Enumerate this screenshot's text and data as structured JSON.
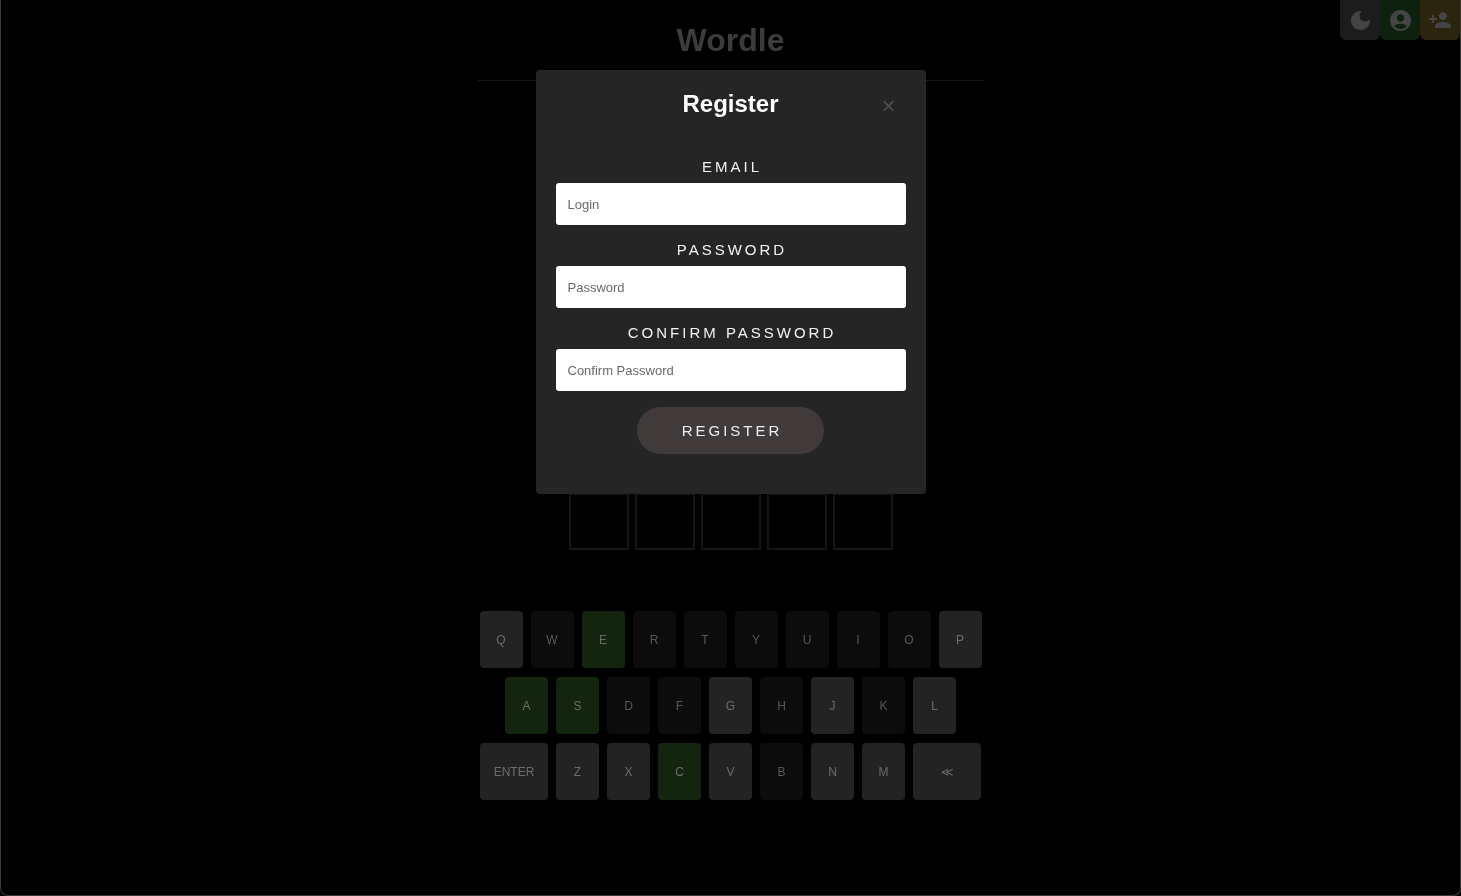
{
  "toolbar": [
    {
      "kind": "theme"
    },
    {
      "kind": "account"
    },
    {
      "kind": "add-user"
    }
  ],
  "header": {
    "title": "Wordle"
  },
  "keyboard": {
    "rows": [
      {
        "keys": [
          {
            "label": "Q",
            "kind": "letter",
            "correct": false,
            "absent": false
          },
          {
            "label": "W",
            "kind": "letter",
            "correct": false,
            "absent": true
          },
          {
            "label": "E",
            "kind": "letter",
            "correct": true,
            "absent": false
          },
          {
            "label": "R",
            "kind": "letter",
            "correct": false,
            "absent": true
          },
          {
            "label": "T",
            "kind": "letter",
            "correct": false,
            "absent": true
          },
          {
            "label": "Y",
            "kind": "letter",
            "correct": false,
            "absent": true
          },
          {
            "label": "U",
            "kind": "letter",
            "correct": false,
            "absent": true
          },
          {
            "label": "I",
            "kind": "letter",
            "correct": false,
            "absent": true
          },
          {
            "label": "O",
            "kind": "letter",
            "correct": false,
            "absent": true
          },
          {
            "label": "P",
            "kind": "letter",
            "correct": false,
            "absent": false
          }
        ]
      },
      {
        "keys": [
          {
            "label": "A",
            "kind": "letter",
            "correct": true,
            "absent": false
          },
          {
            "label": "S",
            "kind": "letter",
            "correct": true,
            "absent": false
          },
          {
            "label": "D",
            "kind": "letter",
            "correct": false,
            "absent": true
          },
          {
            "label": "F",
            "kind": "letter",
            "correct": false,
            "absent": true
          },
          {
            "label": "G",
            "kind": "letter",
            "correct": false,
            "absent": false
          },
          {
            "label": "H",
            "kind": "letter",
            "correct": false,
            "absent": true
          },
          {
            "label": "J",
            "kind": "letter",
            "correct": false,
            "absent": false
          },
          {
            "label": "K",
            "kind": "letter",
            "correct": false,
            "absent": true
          },
          {
            "label": "L",
            "kind": "letter",
            "correct": false,
            "absent": false
          }
        ]
      },
      {
        "keys": [
          {
            "label": "ENTER",
            "kind": "wide",
            "correct": false,
            "absent": false
          },
          {
            "label": "Z",
            "kind": "letter",
            "correct": false,
            "absent": false
          },
          {
            "label": "X",
            "kind": "letter",
            "correct": false,
            "absent": false
          },
          {
            "label": "C",
            "kind": "letter",
            "correct": true,
            "absent": false
          },
          {
            "label": "V",
            "kind": "letter",
            "correct": false,
            "absent": false
          },
          {
            "label": "B",
            "kind": "letter",
            "correct": false,
            "absent": true
          },
          {
            "label": "N",
            "kind": "letter",
            "correct": false,
            "absent": false
          },
          {
            "label": "M",
            "kind": "letter",
            "correct": false,
            "absent": false
          },
          {
            "label": "≪",
            "kind": "wide",
            "correct": false,
            "absent": false
          }
        ]
      }
    ]
  },
  "dialog": {
    "title": "Register",
    "close": "×",
    "fields": [
      {
        "label": "EMAIL",
        "placeholder": "Login"
      },
      {
        "label": "PASSWORD",
        "placeholder": "Password"
      },
      {
        "label": "CONFIRM PASSWORD",
        "placeholder": "Confirm Password"
      }
    ],
    "submit": "REGISTER"
  }
}
